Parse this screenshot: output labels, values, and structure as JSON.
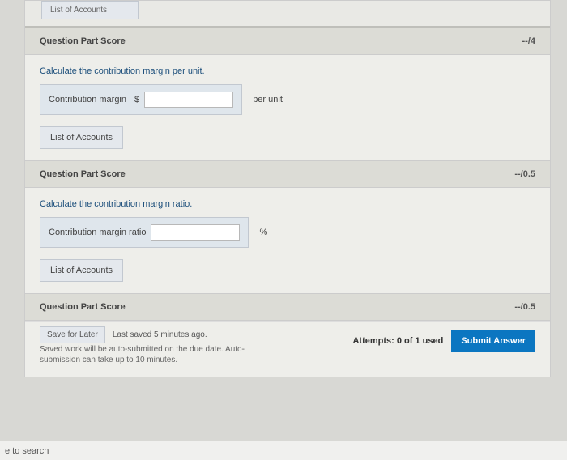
{
  "top": {
    "list_accounts": "List of Accounts"
  },
  "part1": {
    "score_label": "Question Part Score",
    "score_value": "--/4",
    "prompt": "Calculate the contribution margin per unit.",
    "field_label": "Contribution margin",
    "currency": "$",
    "unit_suffix": "per unit",
    "list_accounts": "List of Accounts"
  },
  "part2": {
    "score_label": "Question Part Score",
    "score_value": "--/0.5",
    "prompt": "Calculate the contribution margin ratio.",
    "field_label": "Contribution margin ratio",
    "unit_suffix": "%",
    "list_accounts": "List of Accounts"
  },
  "part3": {
    "score_label": "Question Part Score",
    "score_value": "--/0.5"
  },
  "footer": {
    "save_for_later": "Save for Later",
    "last_saved": "Last saved 5 minutes ago.",
    "note": "Saved work will be auto-submitted on the due date. Auto-submission can take up to 10 minutes.",
    "attempts": "Attempts: 0 of 1 used",
    "submit": "Submit Answer"
  },
  "taskbar": {
    "search": "e to search"
  }
}
